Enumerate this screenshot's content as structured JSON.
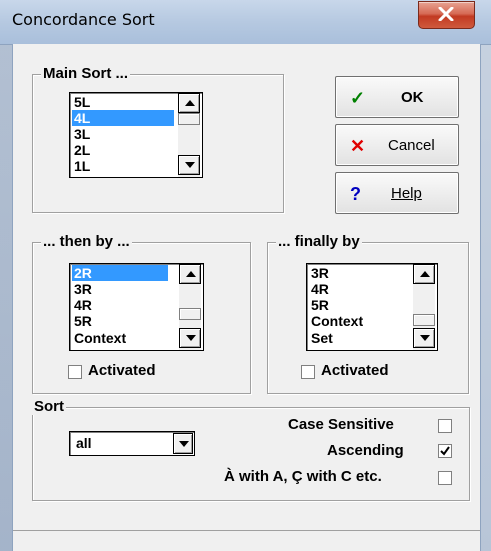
{
  "window": {
    "title": "Concordance Sort"
  },
  "main_sort": {
    "label": "Main Sort ...",
    "items": [
      "5L",
      "4L",
      "3L",
      "2L",
      "1L"
    ],
    "selected_index": 1
  },
  "then_by": {
    "label": "... then by ...",
    "items": [
      "2R",
      "3R",
      "4R",
      "5R",
      "Context"
    ],
    "selected_index": 0,
    "activated_label": "Activated",
    "activated": false
  },
  "finally_by": {
    "label": "... finally by",
    "items": [
      "3R",
      "4R",
      "5R",
      "Context",
      "Set"
    ],
    "selected_index": -1,
    "activated_label": "Activated",
    "activated": false
  },
  "buttons": {
    "ok": {
      "label": "OK",
      "icon": "check-icon",
      "color": "#008000"
    },
    "cancel": {
      "label": "Cancel",
      "icon": "x-icon",
      "color": "#e00000"
    },
    "help": {
      "label": "Help",
      "icon": "question-icon",
      "color": "#0000c0"
    }
  },
  "sort": {
    "label": "Sort",
    "combo_value": "all",
    "options": [
      {
        "label": "Case Sensitive",
        "checked": false
      },
      {
        "label": "Ascending",
        "checked": true
      },
      {
        "label": "À with A, Ç with C etc.",
        "checked": false
      }
    ]
  }
}
